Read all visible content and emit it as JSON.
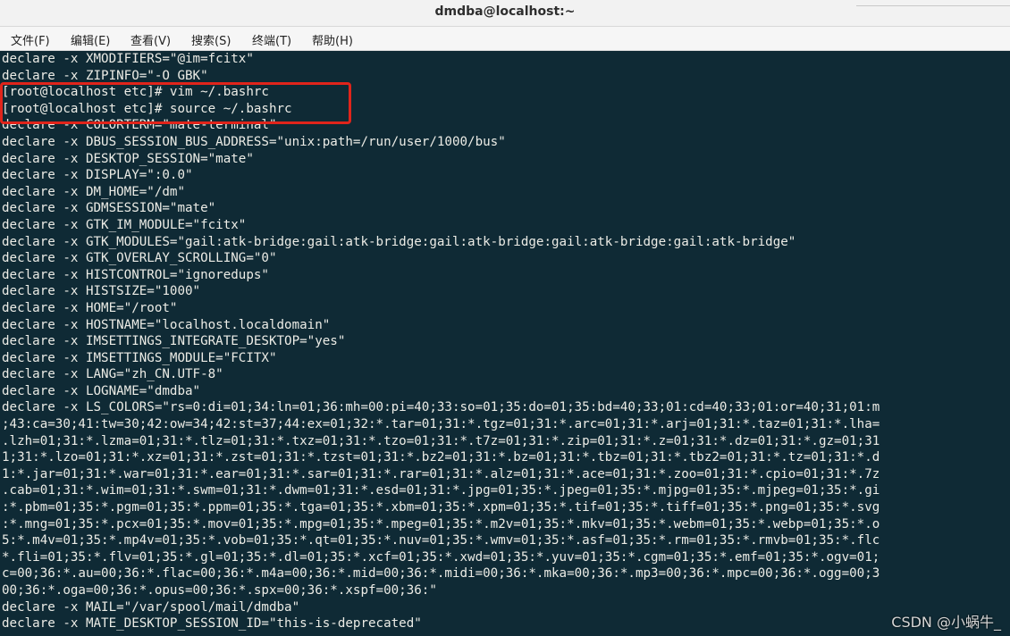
{
  "window": {
    "title": "dmdba@localhost:~"
  },
  "menu": {
    "items": [
      {
        "label": "文件(F)"
      },
      {
        "label": "编辑(E)"
      },
      {
        "label": "查看(V)"
      },
      {
        "label": "搜索(S)"
      },
      {
        "label": "终端(T)"
      },
      {
        "label": "帮助(H)"
      }
    ]
  },
  "terminal": {
    "colors": {
      "background": "#0f2a35",
      "foreground": "#ecece6",
      "highlight_border": "#e0241b"
    },
    "lines": [
      "declare -x XMODIFIERS=\"@im=fcitx\"",
      "declare -x ZIPINFO=\"-O GBK\"",
      "[root@localhost etc]# vim ~/.bashrc",
      "[root@localhost etc]# source ~/.bashrc",
      "declare -x COLORTERM=\"mate-terminal\"",
      "declare -x DBUS_SESSION_BUS_ADDRESS=\"unix:path=/run/user/1000/bus\"",
      "declare -x DESKTOP_SESSION=\"mate\"",
      "declare -x DISPLAY=\":0.0\"",
      "declare -x DM_HOME=\"/dm\"",
      "declare -x GDMSESSION=\"mate\"",
      "declare -x GTK_IM_MODULE=\"fcitx\"",
      "declare -x GTK_MODULES=\"gail:atk-bridge:gail:atk-bridge:gail:atk-bridge:gail:atk-bridge:gail:atk-bridge\"",
      "declare -x GTK_OVERLAY_SCROLLING=\"0\"",
      "declare -x HISTCONTROL=\"ignoredups\"",
      "declare -x HISTSIZE=\"1000\"",
      "declare -x HOME=\"/root\"",
      "declare -x HOSTNAME=\"localhost.localdomain\"",
      "declare -x IMSETTINGS_INTEGRATE_DESKTOP=\"yes\"",
      "declare -x IMSETTINGS_MODULE=\"FCITX\"",
      "declare -x LANG=\"zh_CN.UTF-8\"",
      "declare -x LOGNAME=\"dmdba\"",
      "declare -x LS_COLORS=\"rs=0:di=01;34:ln=01;36:mh=00:pi=40;33:so=01;35:do=01;35:bd=40;33;01:cd=40;33;01:or=40;31;01:m",
      ";43:ca=30;41:tw=30;42:ow=34;42:st=37;44:ex=01;32:*.tar=01;31:*.tgz=01;31:*.arc=01;31:*.arj=01;31:*.taz=01;31:*.lha=",
      ".lzh=01;31:*.lzma=01;31:*.tlz=01;31:*.txz=01;31:*.tzo=01;31:*.t7z=01;31:*.zip=01;31:*.z=01;31:*.dz=01;31:*.gz=01;31",
      "1;31:*.lzo=01;31:*.xz=01;31:*.zst=01;31:*.tzst=01;31:*.bz2=01;31:*.bz=01;31:*.tbz=01;31:*.tbz2=01;31:*.tz=01;31:*.d",
      "1:*.jar=01;31:*.war=01;31:*.ear=01;31:*.sar=01;31:*.rar=01;31:*.alz=01;31:*.ace=01;31:*.zoo=01;31:*.cpio=01;31:*.7z",
      ".cab=01;31:*.wim=01;31:*.swm=01;31:*.dwm=01;31:*.esd=01;31:*.jpg=01;35:*.jpeg=01;35:*.mjpg=01;35:*.mjpeg=01;35:*.gi",
      ":*.pbm=01;35:*.pgm=01;35:*.ppm=01;35:*.tga=01;35:*.xbm=01;35:*.xpm=01;35:*.tif=01;35:*.tiff=01;35:*.png=01;35:*.svg",
      ":*.mng=01;35:*.pcx=01;35:*.mov=01;35:*.mpg=01;35:*.mpeg=01;35:*.m2v=01;35:*.mkv=01;35:*.webm=01;35:*.webp=01;35:*.o",
      "5:*.m4v=01;35:*.mp4v=01;35:*.vob=01;35:*.qt=01;35:*.nuv=01;35:*.wmv=01;35:*.asf=01;35:*.rm=01;35:*.rmvb=01;35:*.flc",
      "*.fli=01;35:*.flv=01;35:*.gl=01;35:*.dl=01;35:*.xcf=01;35:*.xwd=01;35:*.yuv=01;35:*.cgm=01;35:*.emf=01;35:*.ogv=01;",
      "c=00;36:*.au=00;36:*.flac=00;36:*.m4a=00;36:*.mid=00;36:*.midi=00;36:*.mka=00;36:*.mp3=00;36:*.mpc=00;36:*.ogg=00;3",
      "00;36:*.oga=00;36:*.opus=00;36:*.spx=00;36:*.xspf=00;36:\"",
      "declare -x MAIL=\"/var/spool/mail/dmdba\"",
      "declare -x MATE_DESKTOP_SESSION_ID=\"this-is-deprecated\""
    ]
  },
  "watermark": {
    "text": "CSDN @小蜗牛_"
  }
}
